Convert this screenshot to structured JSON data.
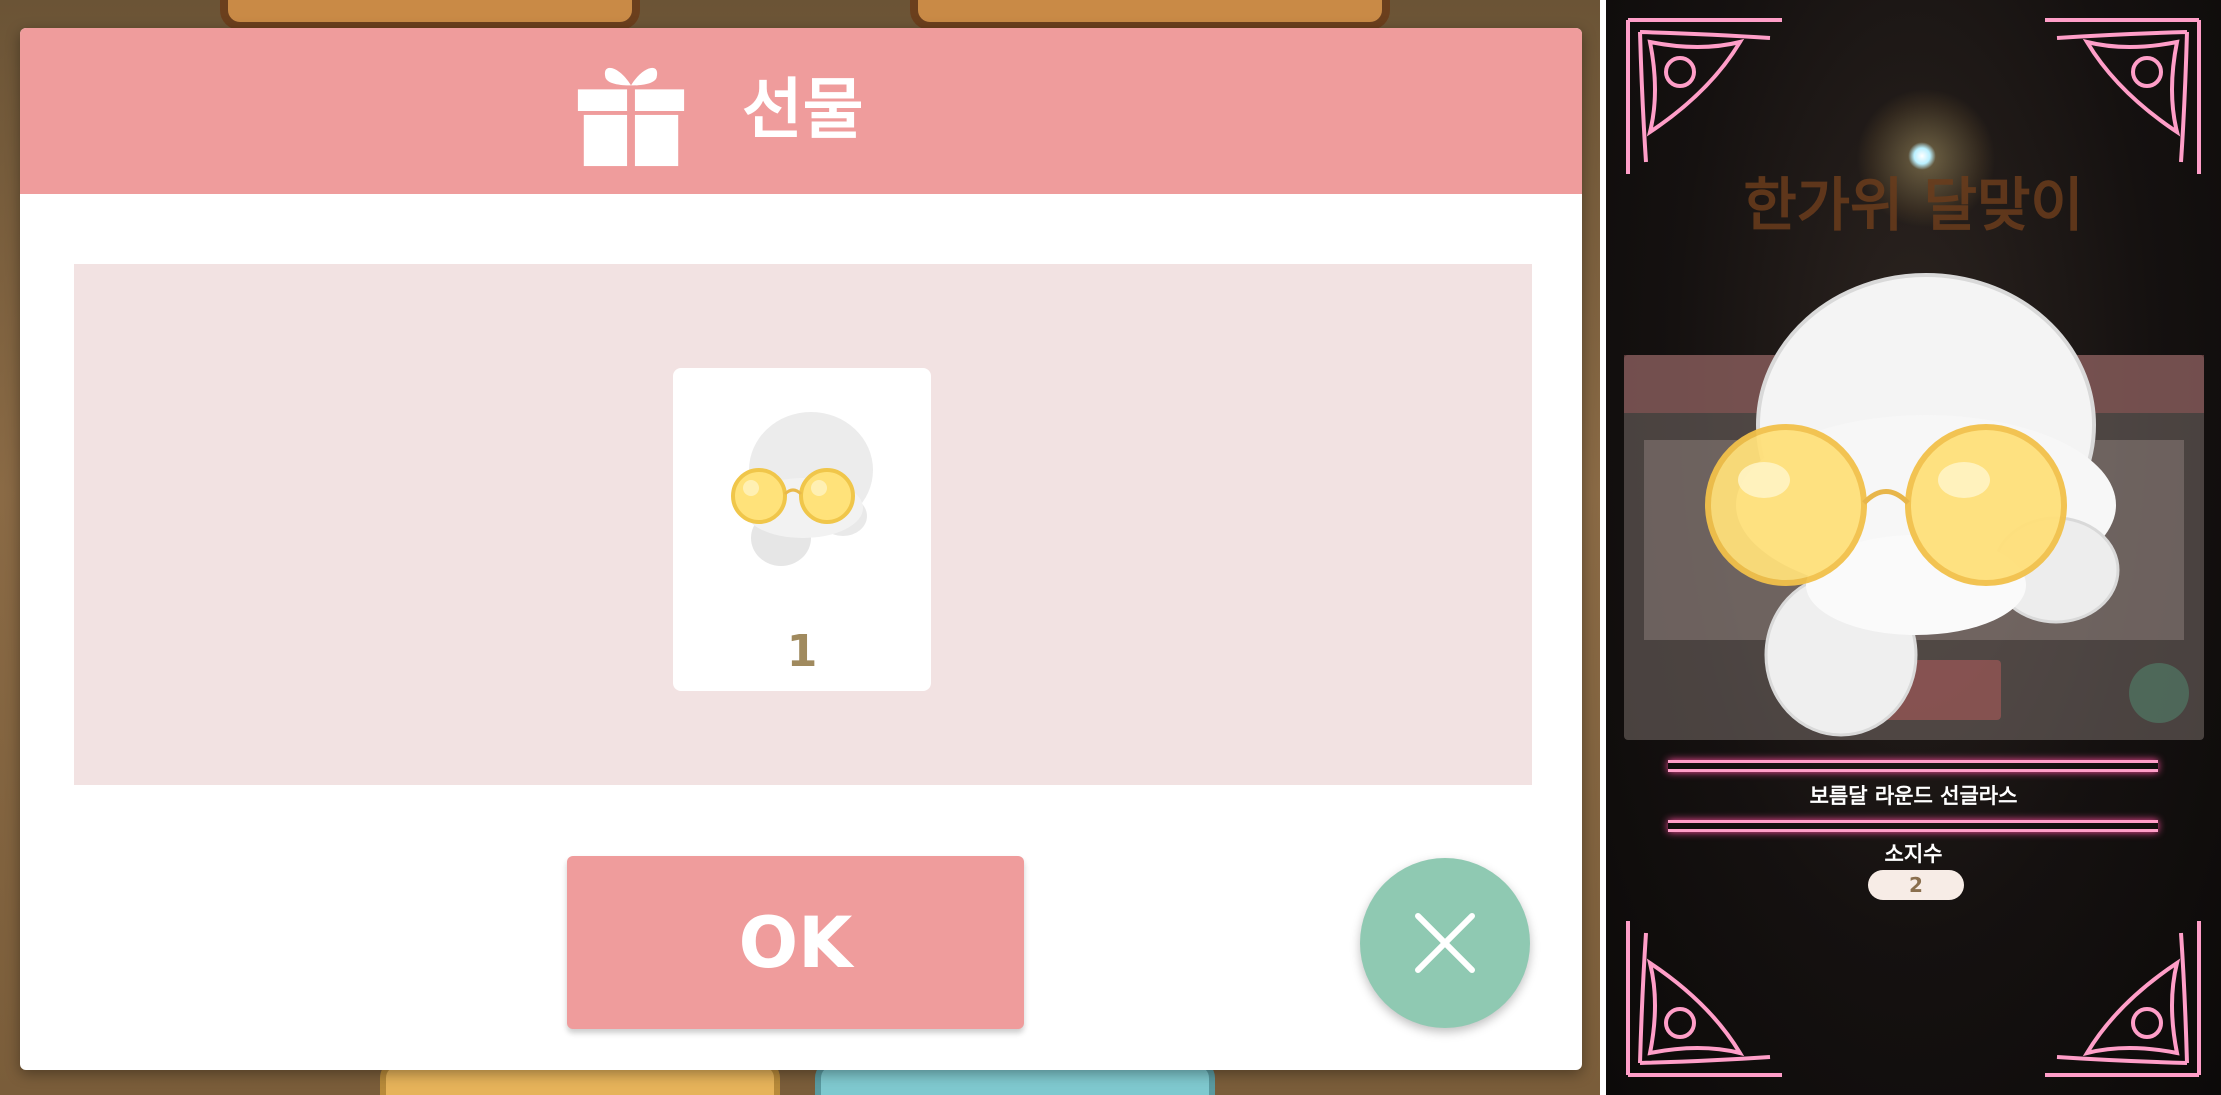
{
  "gift_dialog": {
    "title": "선물",
    "item": {
      "count": "1",
      "image": "round-yellow-sunglasses-icon"
    },
    "ok_label": "OK",
    "close_icon": "close-icon",
    "header_color": "#ef9c9c",
    "close_color": "#8fc9b2"
  },
  "item_detail": {
    "background_title": "한가위 달맞이",
    "item_name": "보름달 라운드 선글라스",
    "owned_label": "소지수",
    "owned_count": "2",
    "accent_color": "#ff9ec8"
  }
}
